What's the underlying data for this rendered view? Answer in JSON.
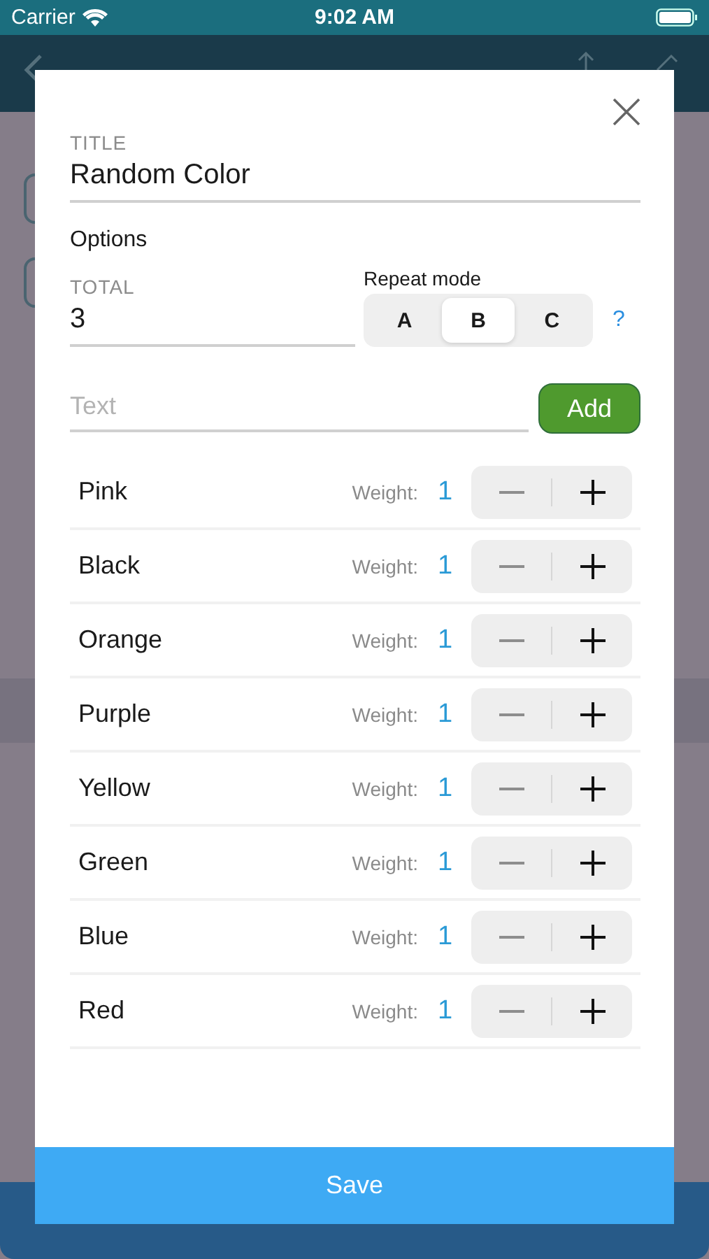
{
  "status_bar": {
    "carrier": "Carrier",
    "time": "9:02 AM"
  },
  "dialog": {
    "title_field": {
      "label": "TITLE",
      "value": "Random Color"
    },
    "options_heading": "Options",
    "total_field": {
      "label": "TOTAL",
      "value": "3"
    },
    "repeat_mode": {
      "label": "Repeat mode",
      "help": "?",
      "segments": [
        {
          "label": "A",
          "selected": false
        },
        {
          "label": "B",
          "selected": true
        },
        {
          "label": "C",
          "selected": false
        }
      ]
    },
    "text_field": {
      "placeholder": "Text"
    },
    "add_button": "Add",
    "items": [
      {
        "name": "Pink",
        "weight_label": "Weight:",
        "weight": "1"
      },
      {
        "name": "Black",
        "weight_label": "Weight:",
        "weight": "1"
      },
      {
        "name": "Orange",
        "weight_label": "Weight:",
        "weight": "1"
      },
      {
        "name": "Purple",
        "weight_label": "Weight:",
        "weight": "1"
      },
      {
        "name": "Yellow",
        "weight_label": "Weight:",
        "weight": "1"
      },
      {
        "name": "Green",
        "weight_label": "Weight:",
        "weight": "1"
      },
      {
        "name": "Blue",
        "weight_label": "Weight:",
        "weight": "1"
      },
      {
        "name": "Red",
        "weight_label": "Weight:",
        "weight": "1"
      }
    ],
    "save_button": "Save"
  }
}
